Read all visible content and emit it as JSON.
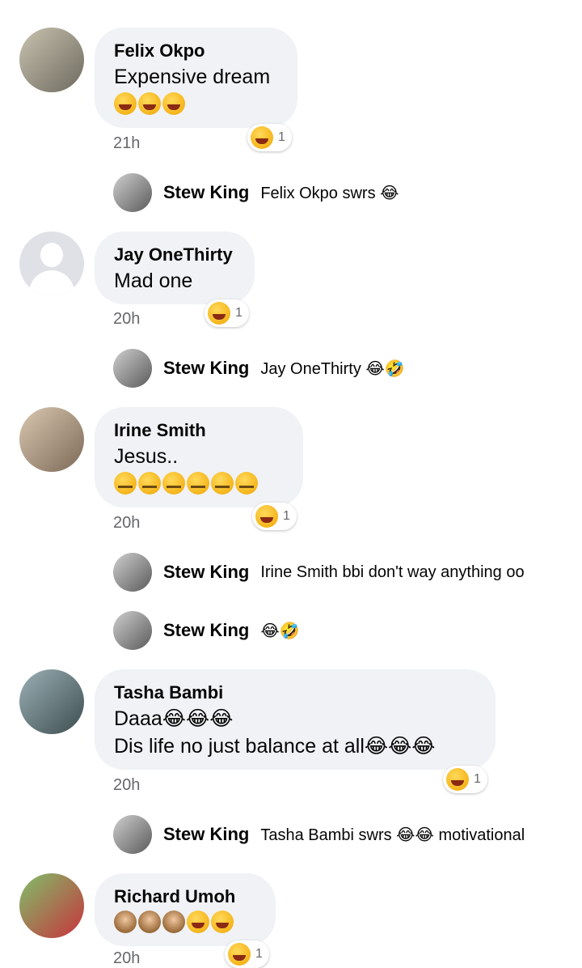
{
  "comments": [
    {
      "name": "Felix Okpo",
      "lines": [
        "Expensive dream"
      ],
      "emoji_line": "🤣🤣🤣",
      "time": "21h",
      "reaction_count": "1"
    },
    {
      "name": "Jay OneThirty",
      "lines": [
        "Mad one"
      ],
      "time": "20h",
      "reaction_count": "1"
    },
    {
      "name": "Irine Smith",
      "lines": [
        "Jesus.."
      ],
      "emoji_line": "🤐🤐🤐🤐🤐🤐",
      "time": "20h",
      "reaction_count": "1"
    },
    {
      "name": "Tasha Bambi",
      "lines": [
        "Daaa😂😂😂",
        "Dis life no just balance at all😂😂😂"
      ],
      "time": "20h",
      "reaction_count": "1"
    },
    {
      "name": "Richard Umoh",
      "emoji_line": "🙊🙊🙊🤣🤣",
      "time": "20h",
      "reaction_count": "1"
    }
  ],
  "replies": [
    {
      "name": "Stew King",
      "text": "Felix Okpo swrs 😂"
    },
    {
      "name": "Stew King",
      "text": "Jay OneThirty 😂🤣"
    },
    {
      "name": "Stew King",
      "text": "Irine Smith bbi don't way anything oo"
    },
    {
      "name": "Stew King",
      "text": "😂🤣"
    },
    {
      "name": "Stew King",
      "text": "Tasha Bambi swrs 😂😂 motivational"
    }
  ],
  "reaction_icon": "laughing-emoji-icon"
}
